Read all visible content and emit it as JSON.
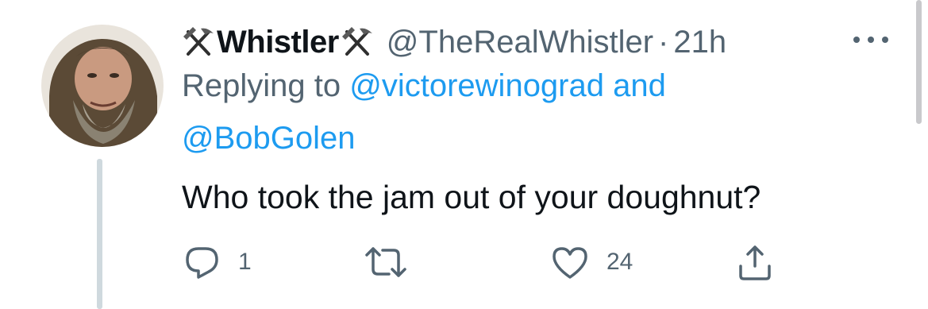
{
  "tweet": {
    "author": {
      "name": "Whistler",
      "handle": "@TheRealWhistler",
      "name_emoji_icon": "hammer-and-pick-icon"
    },
    "separator": "·",
    "time": "21h",
    "replying_prefix": "Replying to",
    "replying_to": [
      "@victorewinograd",
      "@BobGolen"
    ],
    "replying_and": "and",
    "text": "Who took the jam out of your doughnut?",
    "actions": {
      "reply": {
        "icon": "reply-icon",
        "count": "1"
      },
      "retweet": {
        "icon": "retweet-icon",
        "count": ""
      },
      "like": {
        "icon": "heart-icon",
        "count": "24"
      },
      "share": {
        "icon": "share-icon",
        "count": ""
      }
    }
  },
  "colors": {
    "text": "#0f1419",
    "secondary": "#536471",
    "link": "#1d9bf0",
    "thread_line": "#cfd9de"
  }
}
